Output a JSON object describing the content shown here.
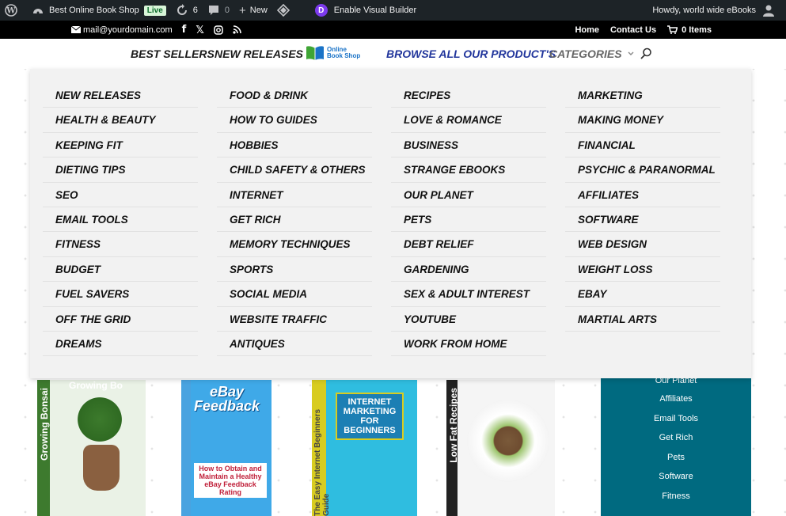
{
  "admin_bar": {
    "site_name": "Best Online Book Shop",
    "live_badge": "Live",
    "updates_count": "6",
    "comments_count": "0",
    "new_label": "New",
    "divi_letter": "D",
    "visual_builder": "Enable Visual Builder",
    "howdy": "Howdy, world wide eBooks"
  },
  "top_bar": {
    "email": "mail@yourdomain.com",
    "links": [
      "Home",
      "Contact Us"
    ],
    "cart": "0 Items"
  },
  "main_nav": {
    "best_sellers": "BEST SELLERS",
    "new_releases": "NEW RELEASES",
    "logo_line1": "Online",
    "logo_line2": "Book Shop",
    "browse": "BROWSE ALL OUR PRODUCT'S",
    "categories": "CATEGORIES"
  },
  "mega_menu": {
    "columns": [
      [
        "NEW RELEASES",
        "HEALTH & BEAUTY",
        "KEEPING FIT",
        "DIETING TIPS",
        "SEO",
        "EMAIL TOOLS",
        "FITNESS",
        "BUDGET",
        "FUEL SAVERS",
        "OFF THE GRID",
        "DREAMS"
      ],
      [
        "FOOD & DRINK",
        "HOW TO GUIDES",
        "HOBBIES",
        "CHILD SAFETY & OTHERS",
        "INTERNET",
        "GET RICH",
        "MEMORY TECHNIQUES",
        "SPORTS",
        "SOCIAL MEDIA",
        "WEBSITE TRAFFIC",
        "ANTIQUES"
      ],
      [
        "RECIPES",
        "LOVE & ROMANCE",
        "BUSINESS",
        "STRANGE EBOOKS",
        "OUR PLANET",
        "PETS",
        "DEBT RELIEF",
        "GARDENING",
        "SEX & ADULT INTEREST",
        "YOUTUBE",
        "WORK FROM HOME"
      ],
      [
        "MARKETING",
        "MAKING MONEY",
        "FINANCIAL",
        "PSYCHIC & PARANORMAL",
        "AFFILIATES",
        "SOFTWARE",
        "WEB DESIGN",
        "WEIGHT LOSS",
        "EBAY",
        "MARTIAL ARTS"
      ]
    ]
  },
  "products": {
    "book1_spine": "Growing Bonsai",
    "book1_title": "Growing Bo",
    "book2_title_a": "eBay",
    "book2_title_b": "Feedback",
    "book2_sub": "How to Obtain and Maintain a Healthy eBay Feedback Rating",
    "book3_title": "INTERNET MARKETING FOR BEGINNERS",
    "book3_spine": "The Easy Internet Beginners Guide",
    "book4_spine": "Low Fat Recipes"
  },
  "sidebar_widget": {
    "items": [
      "Our Planet",
      "Affiliates",
      "Email Tools",
      "Get Rich",
      "Pets",
      "Software",
      "Fitness"
    ]
  },
  "colors": {
    "admin_bar": "#1d2327",
    "browse_link": "#22369c",
    "accent_line": "#2e7bc4",
    "sidebar_bg": "#006a80"
  }
}
